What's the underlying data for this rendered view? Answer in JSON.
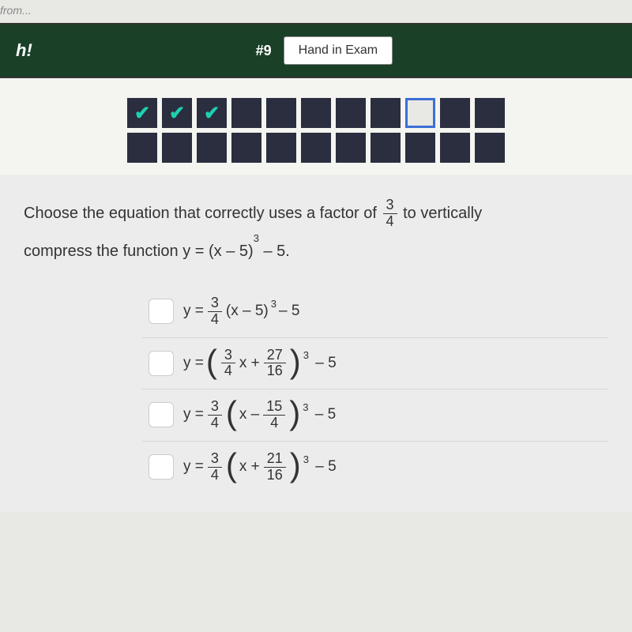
{
  "top_fragment": "from...",
  "header": {
    "left_label": "h!",
    "question_number": "#9",
    "hand_in_label": "Hand in Exam"
  },
  "progress": {
    "row1": [
      {
        "state": "correct"
      },
      {
        "state": "correct"
      },
      {
        "state": "correct"
      },
      {
        "state": "blank"
      },
      {
        "state": "blank"
      },
      {
        "state": "blank"
      },
      {
        "state": "blank"
      },
      {
        "state": "blank"
      },
      {
        "state": "current"
      },
      {
        "state": "blank"
      },
      {
        "state": "blank"
      }
    ],
    "row2": [
      {
        "state": "blank"
      },
      {
        "state": "blank"
      },
      {
        "state": "blank"
      },
      {
        "state": "blank"
      },
      {
        "state": "blank"
      },
      {
        "state": "blank"
      },
      {
        "state": "blank"
      },
      {
        "state": "blank"
      },
      {
        "state": "blank"
      },
      {
        "state": "blank"
      },
      {
        "state": "blank"
      }
    ]
  },
  "question": {
    "part1": "Choose the equation that correctly uses a factor of",
    "factor_num": "3",
    "factor_den": "4",
    "part2": "to vertically",
    "part3": "compress the function y = (x – 5)",
    "part3_exp": "3",
    "part3_tail": " – 5."
  },
  "choices": [
    {
      "prefix": "y =",
      "coef_num": "3",
      "coef_den": "4",
      "inner": "(x – 5)",
      "exp": "3",
      "tail": "– 5",
      "style": "plain"
    },
    {
      "prefix": "y =",
      "inner_num1": "3",
      "inner_den1": "4",
      "inner_op": "x +",
      "inner_num2": "27",
      "inner_den2": "16",
      "exp": "3",
      "tail": "– 5",
      "style": "bigparen_only"
    },
    {
      "prefix": "y =",
      "coef_num": "3",
      "coef_den": "4",
      "inner_op": "x –",
      "inner_num2": "15",
      "inner_den2": "4",
      "exp": "3",
      "tail": "– 5",
      "style": "coef_bigparen"
    },
    {
      "prefix": "y =",
      "coef_num": "3",
      "coef_den": "4",
      "inner_op": "x +",
      "inner_num2": "21",
      "inner_den2": "16",
      "exp": "3",
      "tail": "– 5",
      "style": "coef_bigparen"
    }
  ]
}
